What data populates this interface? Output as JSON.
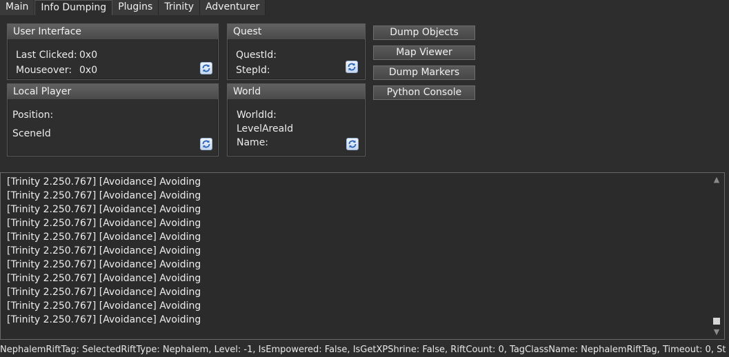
{
  "tabs": [
    "Main",
    "Info Dumping",
    "Plugins",
    "Trinity",
    "Adventurer"
  ],
  "ui_panel": {
    "title": "User Interface",
    "last_clicked_label": "Last Clicked:",
    "last_clicked_value": "0x0",
    "mouseover_label": "Mouseover:",
    "mouseover_value": "0x0"
  },
  "quest_panel": {
    "title": "Quest",
    "quest_id_label": "QuestId:",
    "step_id_label": "StepId:"
  },
  "player_panel": {
    "title": "Local Player",
    "position_label": "Position:",
    "scene_id_label": "SceneId"
  },
  "world_panel": {
    "title": "World",
    "world_id_label": "WorldId:",
    "level_area_label": "LevelAreaId",
    "name_label": "Name:"
  },
  "buttons": [
    "Dump Objects",
    "Map Viewer",
    "Dump Markers",
    "Python Console"
  ],
  "log": {
    "lines": [
      "[Trinity 2.250.767] [Avoidance]  Avoiding",
      "[Trinity 2.250.767] [Avoidance]  Avoiding",
      "[Trinity 2.250.767] [Avoidance]  Avoiding",
      "[Trinity 2.250.767] [Avoidance]  Avoiding",
      "[Trinity 2.250.767] [Avoidance]  Avoiding",
      "[Trinity 2.250.767] [Avoidance]  Avoiding",
      "[Trinity 2.250.767] [Avoidance]  Avoiding",
      "[Trinity 2.250.767] [Avoidance]  Avoiding",
      "[Trinity 2.250.767] [Avoidance]  Avoiding",
      "[Trinity 2.250.767] [Avoidance]  Avoiding",
      "[Trinity 2.250.767] [Avoidance]  Avoiding"
    ]
  },
  "status": "NephalemRiftTag: SelectedRiftType: Nephalem, Level: -1, IsEmpowered: False, IsGetXPShrine: False, RiftCount: 0, TagClassName: NephalemRiftTag, Timeout: 0, St",
  "icons": {
    "refresh": "refresh-icon",
    "scroll_up": "▲",
    "scroll_down": "▼"
  },
  "colors": {
    "background": "#2d2d2d",
    "panel_header": "#555555",
    "text": "#e8e8e8"
  }
}
